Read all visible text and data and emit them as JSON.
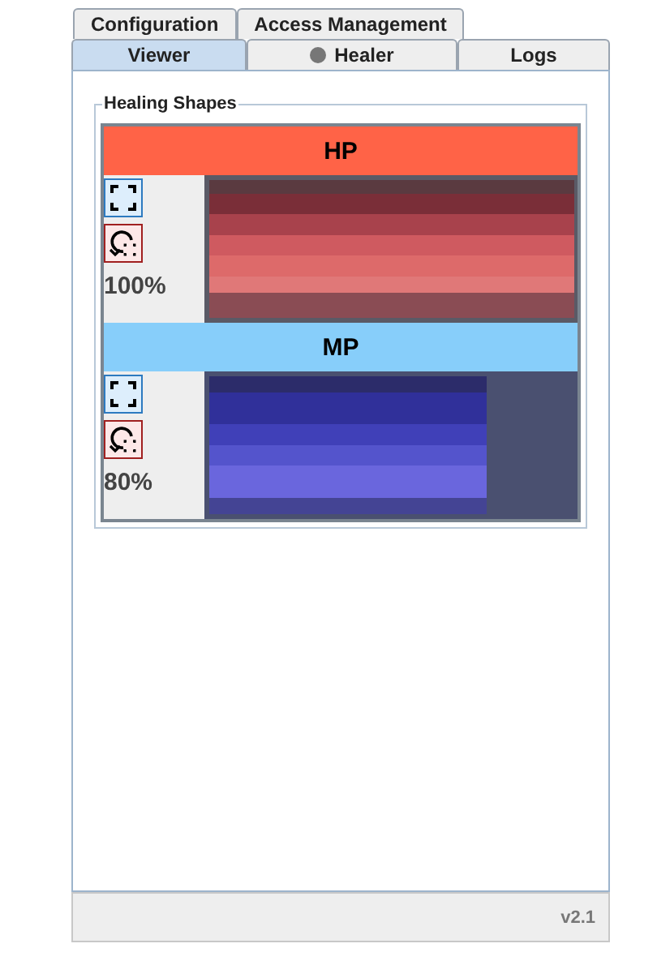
{
  "tabs_top": [
    {
      "label": "Configuration",
      "selected": false
    },
    {
      "label": "Access Management",
      "selected": false
    }
  ],
  "tabs": [
    {
      "label": "Viewer",
      "selected": true,
      "icon": false
    },
    {
      "label": "Healer",
      "selected": false,
      "icon": true
    },
    {
      "label": "Logs",
      "selected": false,
      "icon": false
    }
  ],
  "group": {
    "title": "Healing Shapes",
    "shapes": [
      {
        "kind": "hp",
        "label": "HP",
        "color": "#ff6347",
        "reading": "100%",
        "level": 1.0
      },
      {
        "kind": "mp",
        "label": "MP",
        "color": "#87cefa",
        "reading": "80%",
        "level": 0.76
      }
    ]
  },
  "status_bar": {
    "version": "v2.1"
  }
}
